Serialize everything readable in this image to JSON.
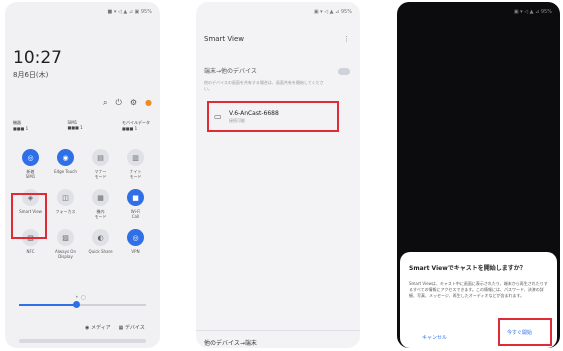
{
  "phone1": {
    "status": "■ ▾ ◁ ▲ ⊿ ▣ 95%",
    "clock": "10:27",
    "date": "8月6日(木)",
    "top_icons": [
      "search-icon",
      "power-icon",
      "gear-icon",
      "more-icon"
    ],
    "chips": [
      {
        "title": "機器",
        "sub": "■■■ 1"
      },
      {
        "title": "SIM1",
        "sub": "■■■ 1"
      },
      {
        "title": "モバイルデータ",
        "sub": "■■■ 1"
      }
    ],
    "tiles": [
      {
        "icon": "◎",
        "label": "新着\nSIM1",
        "on": true
      },
      {
        "icon": "◉",
        "label": "Edge Touch",
        "on": true
      },
      {
        "icon": "▤",
        "label": "マナー\nモード",
        "on": false
      },
      {
        "icon": "▥",
        "label": "ナイト\nモード",
        "on": false
      },
      {
        "icon": "◈",
        "label": "Smart View",
        "on": false
      },
      {
        "icon": "◫",
        "label": "フォーカス",
        "on": false
      },
      {
        "icon": "▦",
        "label": "機内\nモード",
        "on": false
      },
      {
        "icon": "■",
        "label": "Wi-Fi\nCall",
        "on": true
      },
      {
        "icon": "▧",
        "label": "NFC",
        "on": false
      },
      {
        "icon": "▨",
        "label": "Always On\nDisplay",
        "on": false
      },
      {
        "icon": "◐",
        "label": "Quick Share",
        "on": false
      },
      {
        "icon": "◎",
        "label": "VPN",
        "on": true
      }
    ],
    "page_dots": "• ○",
    "media_label": "◉ メディア",
    "device_label": "▦ デバイス",
    "footer": ""
  },
  "phone2": {
    "status": "▣ ▾ ◁ ▲ ⊿ 95%",
    "title": "Smart View",
    "menu": "⋮",
    "section": "端末→他のデバイス",
    "hint": "他のデバイスの画面を共有する場合は、画面共有を開始してください。",
    "device_name": "V.6-AnCast-6688",
    "device_status": "接続可能",
    "bottom_label": "他のデバイス→端末"
  },
  "phone3": {
    "status": "▣ ▾ ◁ ▲ ⊿ 95%",
    "dialog_title": "Smart Viewでキャストを開始しますか？",
    "dialog_body": "Smart Viewは、キャスト中に画面に表示されたり、端末から再生されたりするすべての情報にアクセスできます。この情報には、パスワード、決済の詳細、写真、メッセージ、再生したオーディオなどが含まれます。",
    "cancel": "キャンセル",
    "start": "今すぐ開始"
  }
}
